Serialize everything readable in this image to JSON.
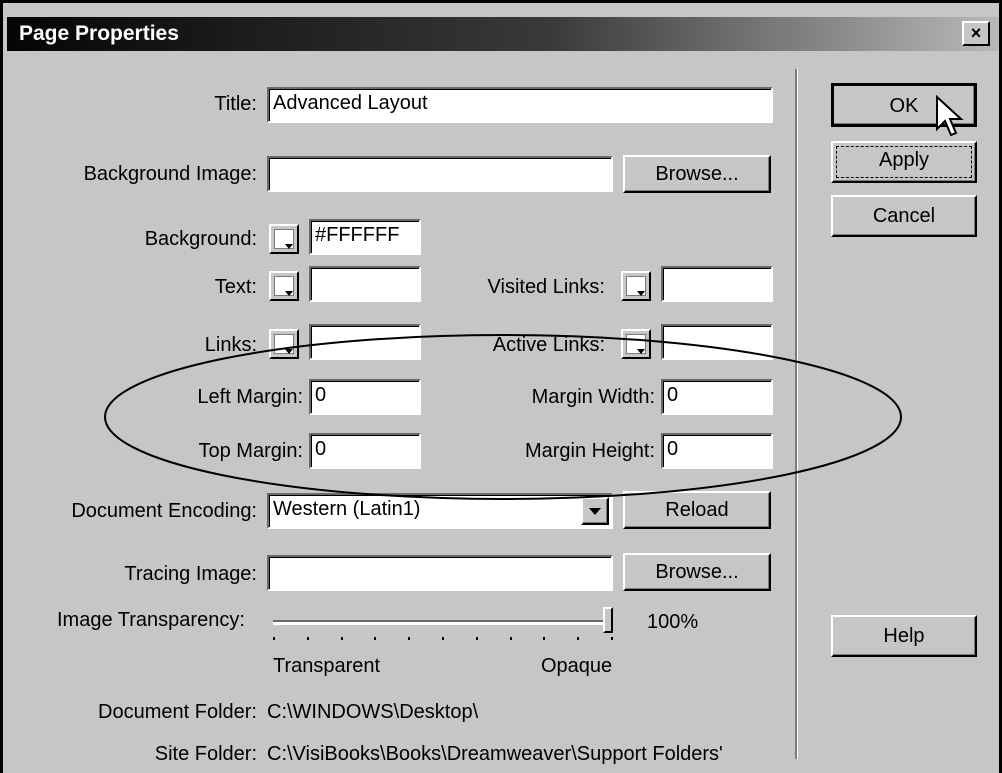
{
  "window": {
    "title": "Page Properties",
    "close_glyph": "×"
  },
  "fields": {
    "title": {
      "label": "Title:",
      "value": "Advanced Layout"
    },
    "background_image": {
      "label": "Background Image:",
      "value": ""
    },
    "background": {
      "label": "Background:",
      "value": "#FFFFFF"
    },
    "text": {
      "label": "Text:",
      "value": ""
    },
    "visited_links": {
      "label": "Visited Links:",
      "value": ""
    },
    "links": {
      "label": "Links:",
      "value": ""
    },
    "active_links": {
      "label": "Active Links:",
      "value": ""
    },
    "left_margin": {
      "label": "Left Margin:",
      "value": "0"
    },
    "margin_width": {
      "label": "Margin Width:",
      "value": "0"
    },
    "top_margin": {
      "label": "Top Margin:",
      "value": "0"
    },
    "margin_height": {
      "label": "Margin Height:",
      "value": "0"
    },
    "document_encoding": {
      "label": "Document Encoding:",
      "value": "Western (Latin1)"
    },
    "tracing_image": {
      "label": "Tracing Image:",
      "value": ""
    }
  },
  "buttons": {
    "ok": "OK",
    "apply": "Apply",
    "cancel": "Cancel",
    "help": "Help",
    "browse": "Browse...",
    "reload": "Reload"
  },
  "transparency": {
    "label": "Image Transparency:",
    "value_text": "100%",
    "value": 1.0,
    "min_label": "Transparent",
    "max_label": "Opaque"
  },
  "info": {
    "document_folder": {
      "label": "Document Folder:",
      "value": "C:\\WINDOWS\\Desktop\\"
    },
    "site_folder": {
      "label": "Site Folder:",
      "value": "C:\\VisiBooks\\Books\\Dreamweaver\\Support Folders'"
    }
  }
}
